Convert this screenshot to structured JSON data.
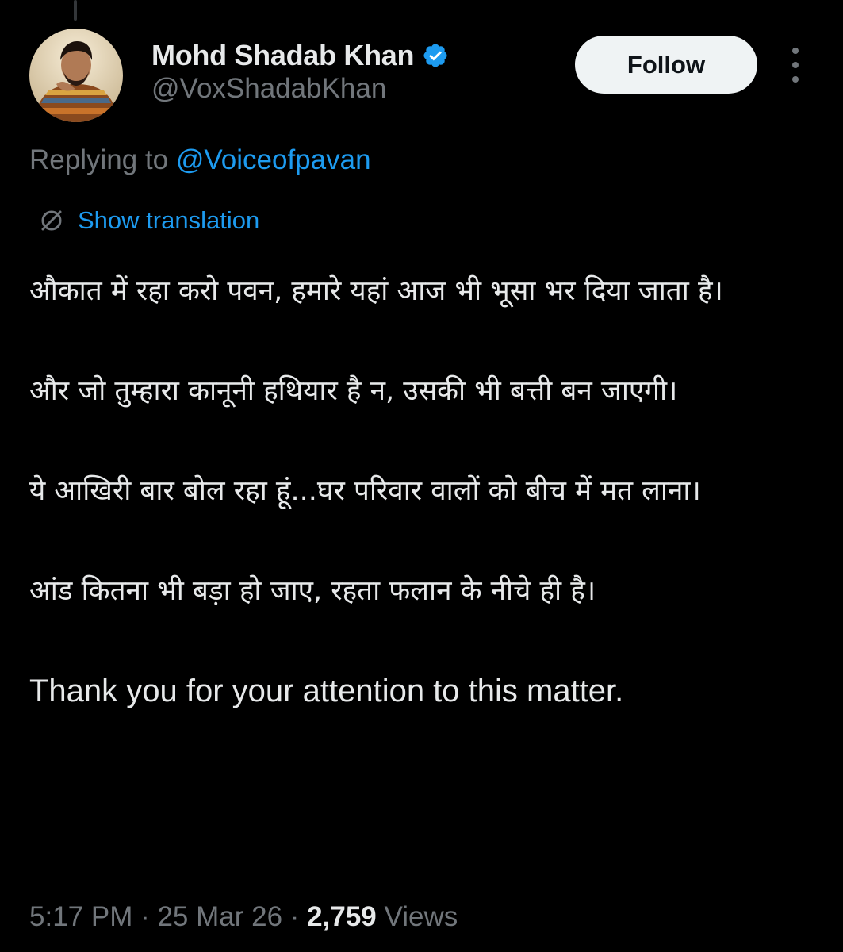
{
  "author": {
    "display_name": "Mohd Shadab Khan",
    "handle": "@VoxShadabKhan",
    "verified": true
  },
  "actions": {
    "follow_label": "Follow",
    "more_icon": "more-vertical-icon"
  },
  "reply": {
    "prefix": "Replying to ",
    "target": "@Voiceofpavan"
  },
  "translation": {
    "label": "Show translation",
    "icon": "translate-icon"
  },
  "tweet": {
    "paragraphs": [
      "औकात में रहा करो पवन, हमारे यहां आज भी भूसा भर दिया जाता है।",
      "और जो तुम्हारा कानूनी हथियार है न, उसकी भी बत्ती बन जाएगी।",
      "ये आखिरी बार बोल रहा हूं...घर परिवार वालों को बीच में मत लाना।",
      "आंड कितना भी बड़ा हो जाए, रहता फलान के नीचे ही है।",
      "Thank you for your attention to this matter."
    ]
  },
  "meta": {
    "time": "5:17 PM",
    "sep1": " · ",
    "date": "25 Mar 26",
    "sep2": " · ",
    "views_count": "2,759",
    "views_label": " Views"
  },
  "colors": {
    "background": "#000000",
    "text_primary": "#e7e9ea",
    "text_secondary": "#71767b",
    "accent": "#1d9bf0",
    "follow_button_bg": "#eff3f4"
  }
}
